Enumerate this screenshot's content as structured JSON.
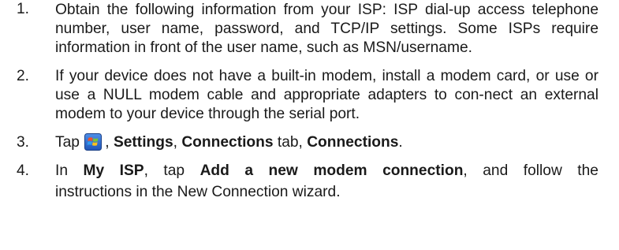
{
  "steps": [
    {
      "num": "1.",
      "text": "Obtain the following information from your ISP: ISP dial-up access telephone number, user name, password, and TCP/IP settings. Some ISPs require information in front of the user name, such as MSN/username."
    },
    {
      "num": "2.",
      "text": "If your device does not have a built-in modem, install a modem card, or use or use a NULL modem cable and appropriate adapters to con-nect an external modem to your device through the serial port."
    },
    {
      "num": "3.",
      "prefix": "Tap",
      "icon": "windows-start-icon",
      "sep1": ", ",
      "b1": "Settings",
      "sep2": ", ",
      "b2": "Connections",
      "mid": " tab, ",
      "b3": "Connections",
      "end": "."
    },
    {
      "num": "4.",
      "prefix": "In ",
      "b1": "My ISP",
      "mid": ", tap ",
      "b2": "Add a new modem connection",
      "rest": ", and follow the",
      "last_line": "instructions in the New Connection wizard."
    }
  ],
  "colors": {
    "text": "#1a1a1a",
    "icon_accent": "#2b6fd6"
  }
}
